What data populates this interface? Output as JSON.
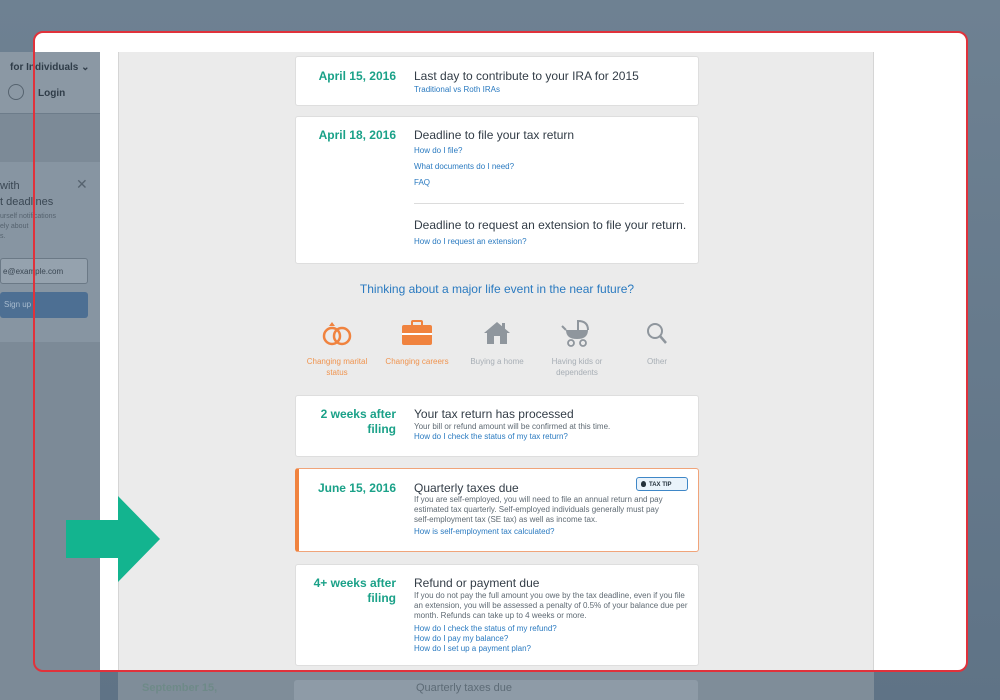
{
  "side_panel": {
    "nav_label": "for Individuals",
    "login_label": "Login",
    "card_heading_1": "with",
    "card_heading_2": "t deadlines",
    "card_sub_1": "urself notifications",
    "card_sub_2": "ely about",
    "card_sub_3": "s.",
    "email_placeholder": "e@example.com",
    "signup_label": "Sign up"
  },
  "timeline": [
    {
      "date": "April 15, 2016",
      "title": "Last day to contribute to your IRA for 2015",
      "links": [
        "Traditional vs Roth IRAs"
      ]
    },
    {
      "date": "April 18, 2016",
      "title": "Deadline to file your tax return",
      "links": [
        "How do I file?",
        "What documents do I need?",
        "FAQ"
      ],
      "title2": "Deadline to request an extension to file your return.",
      "links2": [
        "How do I request an extension?"
      ]
    }
  ],
  "life_events": {
    "question": "Thinking about a major life event in the near future?",
    "items": [
      {
        "label": "Changing marital status",
        "icon": "rings-icon",
        "active": true
      },
      {
        "label": "Changing careers",
        "icon": "briefcase-icon",
        "active": true
      },
      {
        "label": "Buying a home",
        "icon": "house-icon",
        "active": false
      },
      {
        "label": "Having kids or dependents",
        "icon": "stroller-icon",
        "active": false
      },
      {
        "label": "Other",
        "icon": "magnifier-icon",
        "active": false
      }
    ]
  },
  "timeline2": [
    {
      "date_1": "2 weeks after",
      "date_2": "filing",
      "title": "Your tax return has processed",
      "body": "Your bill or refund amount will be confirmed at this time.",
      "links": [
        "How do I check the status of my tax return?"
      ]
    },
    {
      "date": "June 15, 2016",
      "title": "Quarterly taxes due",
      "badge": "TAX TIP",
      "body": "If you are self-employed, you will need to file an annual return and pay estimated tax quarterly. Self-employed individuals generally must pay self-employment tax (SE tax) as well as income tax.",
      "links": [
        "How is self-employment tax calculated?"
      ]
    },
    {
      "date_1": "4+ weeks after",
      "date_2": "filing",
      "title": "Refund or payment due",
      "body": "If you do not pay the full amount you owe by the tax deadline, even if you file an extension, you will be assessed a penalty of 0.5% of your balance due per month. Refunds can take up to 4 weeks or more.",
      "links": [
        "How do I check the status of my refund?",
        "How do I pay my balance?",
        "How do I set up a payment plan?"
      ]
    }
  ],
  "bottom_peek": {
    "date": "September 15,",
    "title": "Quarterly taxes due"
  },
  "colors": {
    "accent_green": "#1aa188",
    "link_blue": "#2a7ac0",
    "tip_orange": "#f0833f",
    "frame_red": "#e0323b",
    "arrow_green": "#13b48f"
  }
}
